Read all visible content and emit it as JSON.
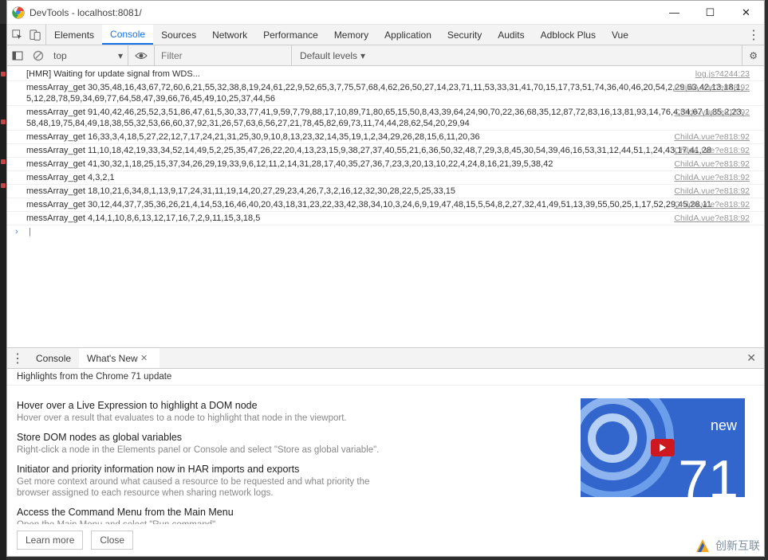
{
  "window": {
    "title": "DevTools - localhost:8081/"
  },
  "tabs": [
    "Elements",
    "Console",
    "Sources",
    "Network",
    "Performance",
    "Memory",
    "Application",
    "Security",
    "Audits",
    "Adblock Plus",
    "Vue"
  ],
  "active_tab": "Console",
  "toolbar": {
    "context": "top",
    "filter_placeholder": "Filter",
    "levels": "Default levels"
  },
  "logs": [
    {
      "text": "[HMR] Waiting for update signal from WDS...",
      "src": "log.js?4244:23"
    },
    {
      "text": "messArray_get 30,35,48,16,43,67,72,60,6,21,55,32,38,8,19,24,61,22,9,52,65,3,7,75,57,68,4,62,26,50,27,14,23,71,11,53,33,31,41,70,15,17,73,51,74,36,40,46,20,54,2,29,63,42,13,18,1,5,12,28,78,59,34,69,77,64,58,47,39,66,76,45,49,10,25,37,44,56",
      "src": "ChildA.vue?e818:92"
    },
    {
      "text": "messArray_get 91,40,42,46,25,52,3,51,86,47,61,5,30,33,77,41,9,59,7,79,88,17,10,89,71,80,65,15,50,8,43,39,64,24,90,70,22,36,68,35,12,87,72,83,16,13,81,93,14,76,4,34,67,1,85,2,23,58,48,19,75,84,49,18,38,55,32,53,66,60,37,92,31,26,57,63,6,56,27,21,78,45,82,69,73,11,74,44,28,62,54,20,29,94",
      "src": "ChildA.vue?e818:92"
    },
    {
      "text": "messArray_get 16,33,3,4,18,5,27,22,12,7,17,24,21,31,25,30,9,10,8,13,23,32,14,35,19,1,2,34,29,26,28,15,6,11,20,36",
      "src": "ChildA.vue?e818:92"
    },
    {
      "text": "messArray_get 11,10,18,42,19,33,34,52,14,49,5,2,25,35,47,26,22,20,4,13,23,15,9,38,27,37,40,55,21,6,36,50,32,48,7,29,3,8,45,30,54,39,46,16,53,31,12,44,51,1,24,43,17,41,28",
      "src": "ChildA.vue?e818:92"
    },
    {
      "text": "messArray_get 41,30,32,1,18,25,15,37,34,26,29,19,33,9,6,12,11,2,14,31,28,17,40,35,27,36,7,23,3,20,13,10,22,4,24,8,16,21,39,5,38,42",
      "src": "ChildA.vue?e818:92"
    },
    {
      "text": "messArray_get 4,3,2,1",
      "src": "ChildA.vue?e818:92"
    },
    {
      "text": "messArray_get 18,10,21,6,34,8,1,13,9,17,24,31,11,19,14,20,27,29,23,4,26,7,3,2,16,12,32,30,28,22,5,25,33,15",
      "src": "ChildA.vue?e818:92"
    },
    {
      "text": "messArray_get 30,12,44,37,7,35,36,26,21,4,14,53,16,46,40,20,43,18,31,23,22,33,42,38,34,10,3,24,6,9,19,47,48,15,5,54,8,2,27,32,41,49,51,13,39,55,50,25,1,17,52,29,45,28,11",
      "src": "ChildA.vue?e818:92"
    },
    {
      "text": "messArray_get 4,14,1,10,8,6,13,12,17,16,7,2,9,11,15,3,18,5",
      "src": "ChildA.vue?e818:92"
    }
  ],
  "drawer": {
    "tabs": [
      "Console",
      "What's New"
    ],
    "active": "What's New",
    "subtitle": "Highlights from the Chrome 71 update",
    "items": [
      {
        "h": "Hover over a Live Expression to highlight a DOM node",
        "p": "Hover over a result that evaluates to a node to highlight that node in the viewport."
      },
      {
        "h": "Store DOM nodes as global variables",
        "p": "Right-click a node in the Elements panel or Console and select \"Store as global variable\"."
      },
      {
        "h": "Initiator and priority information now in HAR imports and exports",
        "p": "Get more context around what caused a resource to be requested and what priority the browser assigned to each resource when sharing network logs."
      },
      {
        "h": "Access the Command Menu from the Main Menu",
        "p": "Open the Main Menu and select \"Run command\"."
      }
    ],
    "buttons": {
      "learn": "Learn more",
      "close": "Close"
    },
    "promo": {
      "label": "new",
      "version": "71"
    }
  },
  "watermark": "创新互联"
}
